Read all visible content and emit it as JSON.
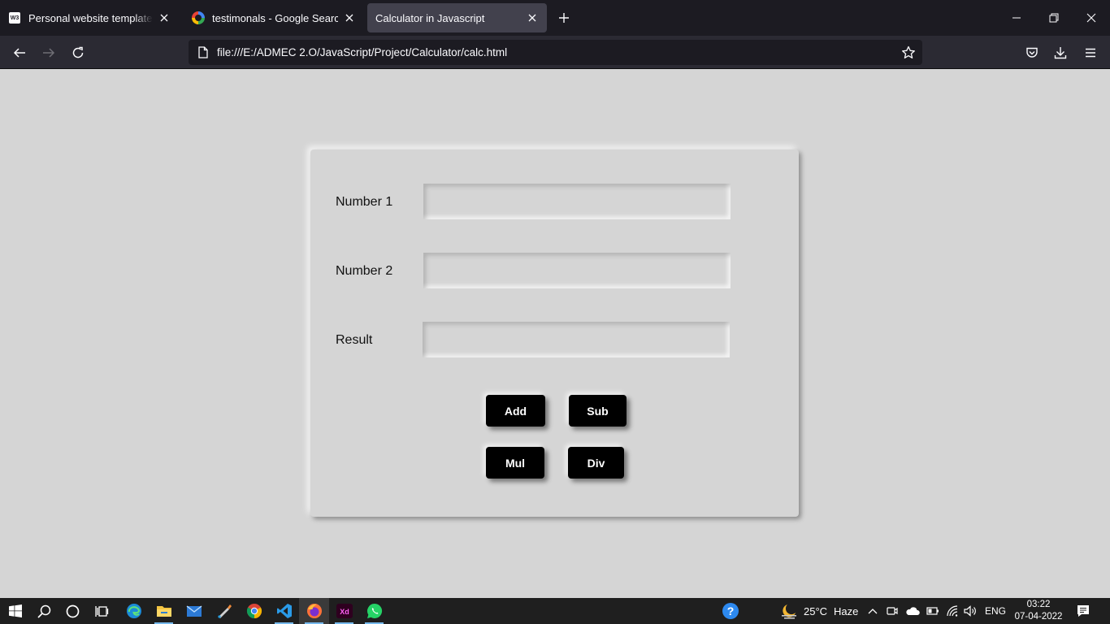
{
  "browser": {
    "tabs": [
      {
        "title": "Personal website templates for F",
        "favicon": "w3schools-icon",
        "favicon_text": "W3",
        "active": false
      },
      {
        "title": "testimonals - Google Search",
        "favicon": "google-icon",
        "active": false
      },
      {
        "title": "Calculator in Javascript",
        "favicon": "none",
        "active": true
      }
    ],
    "url": "file:///E:/ADMEC 2.O/JavaScript/Project/Calculator/calc.html"
  },
  "calculator": {
    "fields": [
      {
        "label": "Number 1",
        "value": ""
      },
      {
        "label": "Number 2",
        "value": ""
      },
      {
        "label": "Result",
        "value": ""
      }
    ],
    "buttons": {
      "add": "Add",
      "sub": "Sub",
      "mul": "Mul",
      "div": "Div"
    }
  },
  "taskbar": {
    "pinned": [
      "windows-start-icon",
      "search-icon",
      "cortana-icon",
      "task-view-icon",
      "edge-icon",
      "file-explorer-icon",
      "mail-icon",
      "paint-icon",
      "chrome-icon",
      "vscode-icon",
      "firefox-icon",
      "adobe-xd-icon",
      "whatsapp-icon"
    ],
    "xd_label": "Xd",
    "weather": {
      "temperature": "25°C",
      "condition": "Haze"
    },
    "language": "ENG",
    "time": "03:22",
    "date": "07-04-2022"
  },
  "colors": {
    "page_background": "#d5d5d5",
    "button_background": "#000000",
    "button_text": "#ffffff",
    "tabbar_background": "#1c1b22",
    "toolbar_background": "#2b2a33"
  }
}
